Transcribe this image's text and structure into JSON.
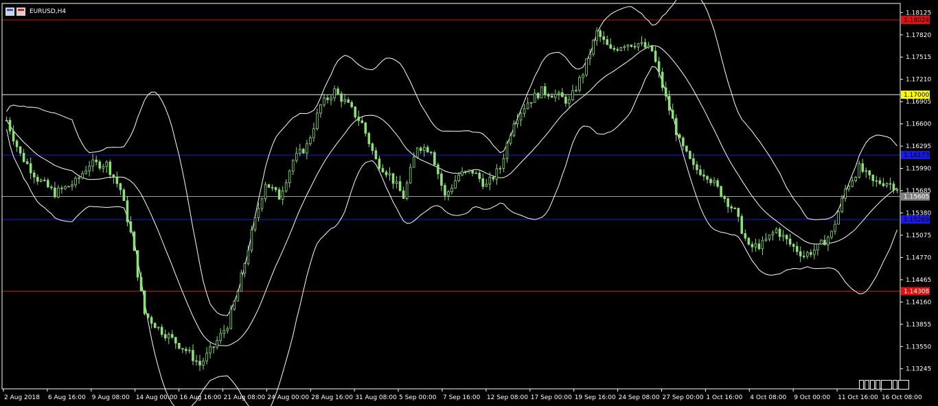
{
  "window": {
    "symbol": "EURUSD,H4",
    "icons": [
      "chart-window-icon",
      "chart-window-icon-alt"
    ]
  },
  "colors": {
    "background": "#000000",
    "candle": "#8ee07a",
    "bands": "#ffffff",
    "axis": "#ffffff",
    "red_level": "#e01010",
    "blue_level": "#1a1ae0",
    "white_level": "#f0f0f0",
    "bid_line": "#a0a0a0",
    "yellow_tag": "#ffff00"
  },
  "chart_data": {
    "type": "candlestick",
    "symbol": "EURUSD",
    "timeframe": "H4",
    "ylim": [
      1.1297,
      1.1825
    ],
    "y_ticks": [
      "1.18125",
      "1.17820",
      "1.17515",
      "1.17210",
      "1.16905",
      "1.16600",
      "1.16295",
      "1.15990",
      "1.15685",
      "1.15380",
      "1.15075",
      "1.14770",
      "1.14465",
      "1.14160",
      "1.13855",
      "1.13550",
      "1.13245"
    ],
    "x_ticks": [
      "2 Aug 2018",
      "6 Aug 16:00",
      "9 Aug 08:00",
      "14 Aug 00:00",
      "16 Aug 16:00",
      "21 Aug 08:00",
      "24 Aug 00:00",
      "28 Aug 16:00",
      "31 Aug 08:00",
      "5 Sep 00:00",
      "7 Sep 16:00",
      "12 Sep 08:00",
      "17 Sep 00:00",
      "19 Sep 16:00",
      "24 Sep 08:00",
      "27 Sep 00:00",
      "1 Oct 16:00",
      "4 Oct 08:00",
      "9 Oct 00:00",
      "11 Oct 16:00",
      "16 Oct 08:00"
    ],
    "price_path": [
      [
        0,
        1.1665
      ],
      [
        4,
        1.1618
      ],
      [
        9,
        1.1585
      ],
      [
        14,
        1.1565
      ],
      [
        20,
        1.158
      ],
      [
        24,
        1.1605
      ],
      [
        29,
        1.1605
      ],
      [
        33,
        1.157
      ],
      [
        36,
        1.151
      ],
      [
        40,
        1.14
      ],
      [
        44,
        1.138
      ],
      [
        48,
        1.1365
      ],
      [
        52,
        1.135
      ],
      [
        56,
        1.133
      ],
      [
        60,
        1.1355
      ],
      [
        64,
        1.1385
      ],
      [
        67,
        1.143
      ],
      [
        71,
        1.151
      ],
      [
        75,
        1.158
      ],
      [
        79,
        1.156
      ],
      [
        83,
        1.161
      ],
      [
        87,
        1.163
      ],
      [
        91,
        1.1685
      ],
      [
        95,
        1.1705
      ],
      [
        99,
        1.1685
      ],
      [
        103,
        1.166
      ],
      [
        107,
        1.161
      ],
      [
        111,
        1.159
      ],
      [
        115,
        1.156
      ],
      [
        119,
        1.163
      ],
      [
        123,
        1.1625
      ],
      [
        127,
        1.156
      ],
      [
        131,
        1.159
      ],
      [
        135,
        1.1595
      ],
      [
        139,
        1.1575
      ],
      [
        143,
        1.16
      ],
      [
        147,
        1.1665
      ],
      [
        151,
        1.169
      ],
      [
        155,
        1.1705
      ],
      [
        159,
        1.17
      ],
      [
        163,
        1.169
      ],
      [
        167,
        1.173
      ],
      [
        171,
        1.1785
      ],
      [
        175,
        1.176
      ],
      [
        179,
        1.177
      ],
      [
        183,
        1.177
      ],
      [
        187,
        1.176
      ],
      [
        191,
        1.1695
      ],
      [
        195,
        1.1635
      ],
      [
        199,
        1.16
      ],
      [
        203,
        1.159
      ],
      [
        207,
        1.1565
      ],
      [
        211,
        1.154
      ],
      [
        215,
        1.149
      ],
      [
        219,
        1.1495
      ],
      [
        223,
        1.1515
      ],
      [
        227,
        1.1495
      ],
      [
        231,
        1.148
      ],
      [
        235,
        1.149
      ],
      [
        239,
        1.151
      ],
      [
        243,
        1.157
      ],
      [
        247,
        1.16
      ],
      [
        251,
        1.158
      ],
      [
        255,
        1.158
      ],
      [
        258,
        1.1573
      ]
    ],
    "candle_count": 259,
    "bollinger_bands": {
      "period": 20,
      "deviations": 2
    },
    "horizontal_lines": [
      {
        "price": 1.18024,
        "label": "1.18024",
        "color": "#e01010",
        "tag_bg": "#e01010",
        "tag_fg": "#000000"
      },
      {
        "price": 1.17,
        "label": "1.17000",
        "color": "#f0f0f0",
        "tag_bg": "#ffff00",
        "tag_fg": "#000000"
      },
      {
        "price": 1.16173,
        "label": "1.16173",
        "color": "#1a1ae0",
        "tag_bg": "#1a1ae0",
        "tag_fg": "#000000"
      },
      {
        "price": 1.15605,
        "label": "1.15605",
        "color": "#a0a0a0",
        "tag_bg": "#808080",
        "tag_fg": "#ffffff"
      },
      {
        "price": 1.15289,
        "label": "1.15289",
        "color": "#1a1ae0",
        "tag_bg": "#1a1ae0",
        "tag_fg": "#000000"
      },
      {
        "price": 1.14308,
        "label": "1.14308",
        "color": "#e01010",
        "tag_bg": "#e01010",
        "tag_fg": "#ffffff"
      }
    ]
  }
}
